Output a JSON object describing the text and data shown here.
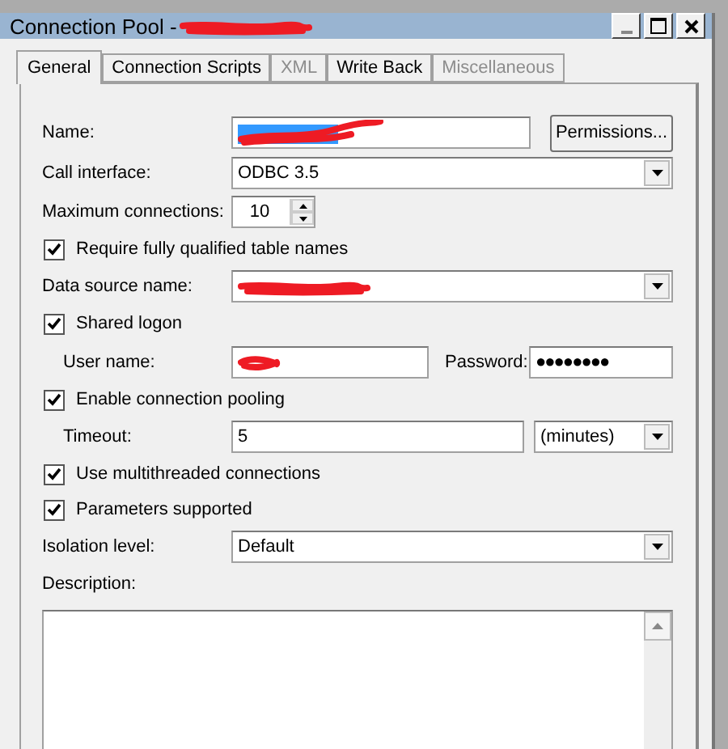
{
  "window": {
    "title": "Connection Pool - ",
    "title_redacted": true
  },
  "tabs": [
    {
      "label": "General",
      "selected": true,
      "disabled": false
    },
    {
      "label": "Connection Scripts",
      "selected": false,
      "disabled": false
    },
    {
      "label": "XML",
      "selected": false,
      "disabled": true
    },
    {
      "label": "Write Back",
      "selected": false,
      "disabled": false
    },
    {
      "label": "Miscellaneous",
      "selected": false,
      "disabled": true
    }
  ],
  "rows": [
    {
      "kind": "text",
      "label": "Name:",
      "redacted": true,
      "button": {
        "label": "Permissions..."
      }
    },
    {
      "kind": "combo",
      "label": "Call interface:",
      "value": "ODBC 3.5"
    },
    {
      "kind": "spin",
      "label": "Maximum connections:",
      "value": "10"
    },
    {
      "kind": "checkbox",
      "label": "Require fully qualified table names",
      "checked": true
    },
    {
      "kind": "combo",
      "label": "Data source name:",
      "redacted": true
    },
    {
      "kind": "checkbox",
      "label": "Shared logon",
      "checked": true
    },
    {
      "kind": "login",
      "label": "User name:",
      "redacted": true,
      "password_label": "Password:",
      "password": "●●●●●●●●"
    },
    {
      "kind": "checkbox",
      "label": "Enable connection pooling",
      "checked": true
    },
    {
      "kind": "timeout",
      "label": "Timeout:",
      "value": "5",
      "unit": "(minutes)"
    },
    {
      "kind": "checkbox",
      "label": "Use multithreaded connections",
      "checked": true
    },
    {
      "kind": "checkbox",
      "label": "Parameters supported",
      "checked": true
    },
    {
      "kind": "combo",
      "label": "Isolation level:",
      "value": "Default"
    },
    {
      "kind": "textarea",
      "label": "Description:"
    }
  ]
}
